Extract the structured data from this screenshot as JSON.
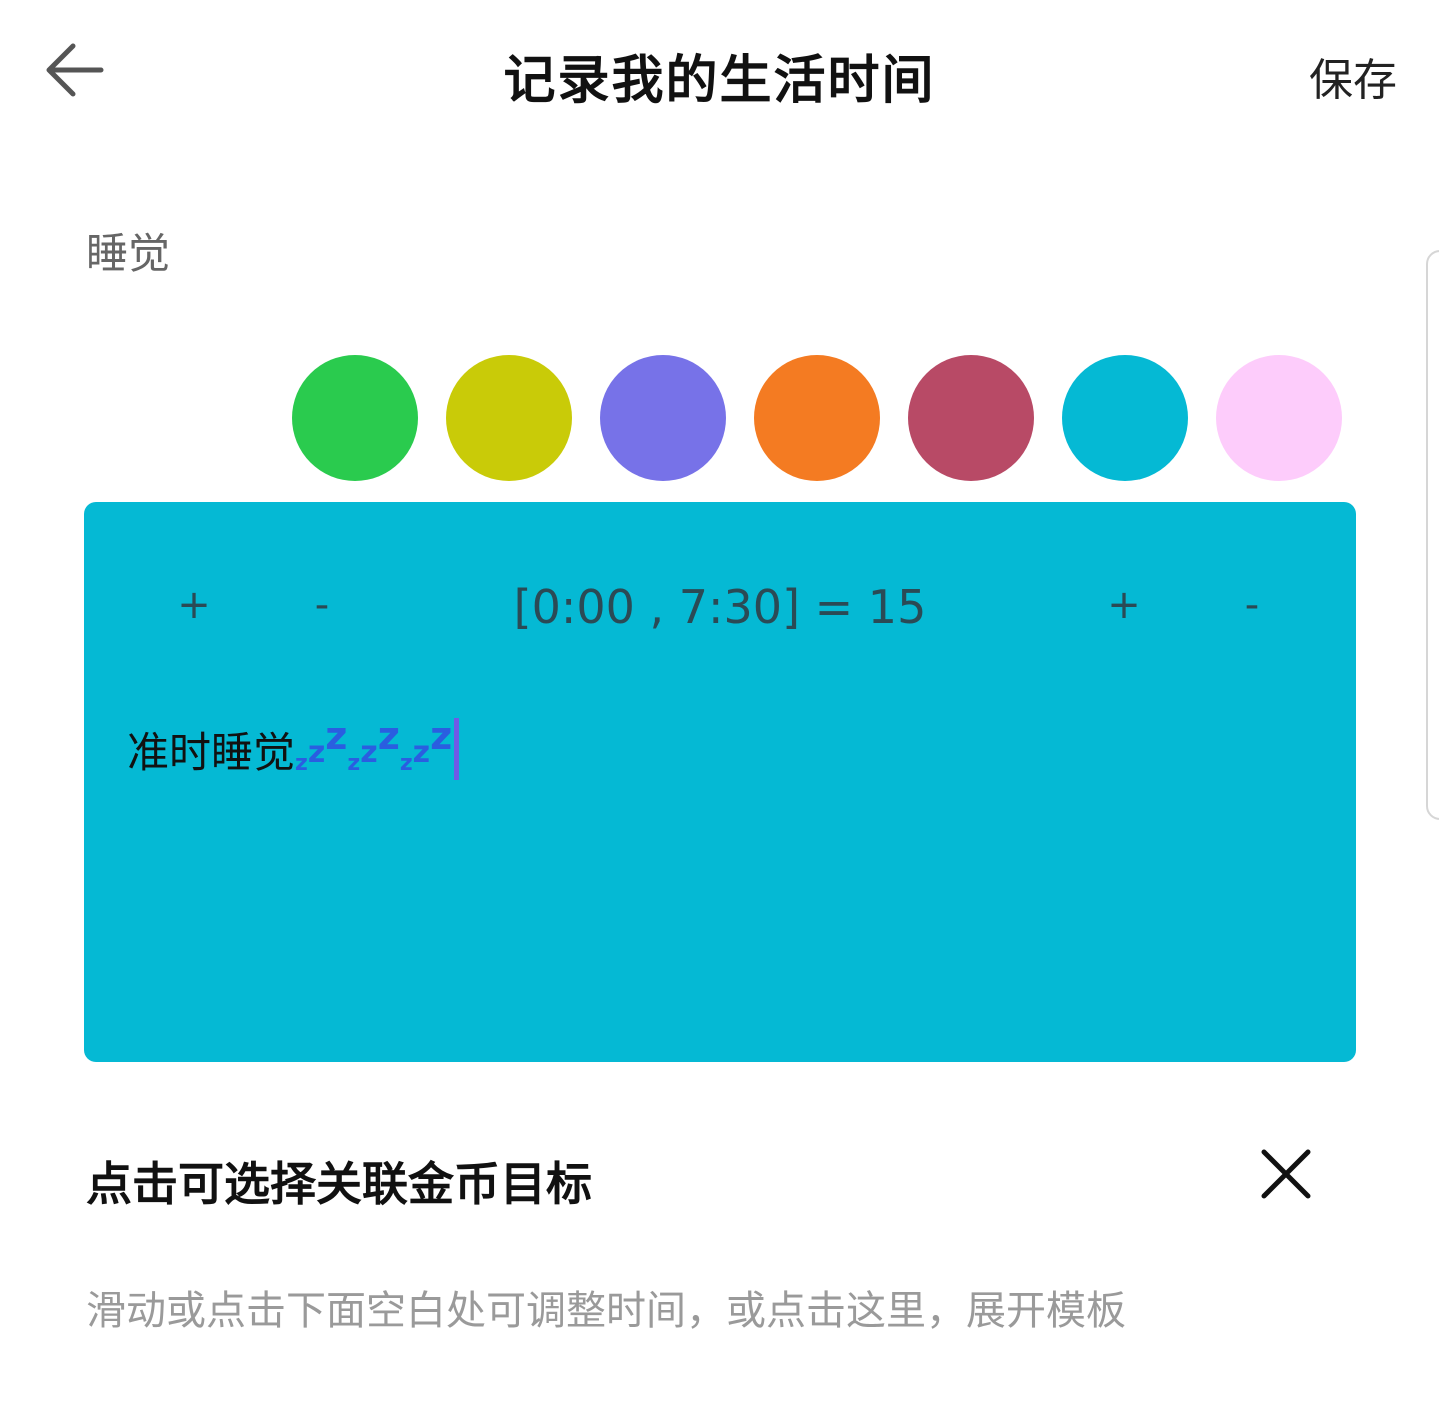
{
  "header": {
    "back_icon": "arrow-left-icon",
    "title": "记录我的生活时间",
    "save_label": "保存"
  },
  "category": {
    "name": "睡觉"
  },
  "colors": {
    "swatches": [
      "#2acb4e",
      "#c9cb08",
      "#7772e8",
      "#f47b22",
      "#b84a66",
      "#05b9d4",
      "#fdccfb"
    ],
    "selected": "#05b9d4",
    "text_dark": "#2b4a55",
    "zz_blue": "#2a5ee0"
  },
  "card": {
    "start_plus": "+",
    "start_minus": "-",
    "range": "[0:00 , 7:30] = 15",
    "end_plus": "+",
    "end_minus": "-",
    "note": "准时睡觉",
    "note_emoji": "zzz-sleep-icon"
  },
  "goal": {
    "label": "点击可选择关联金币目标",
    "close_icon": "close-icon"
  },
  "hint": {
    "text": "滑动或点击下面空白处可调整时间，或点击这里，展开模板"
  }
}
